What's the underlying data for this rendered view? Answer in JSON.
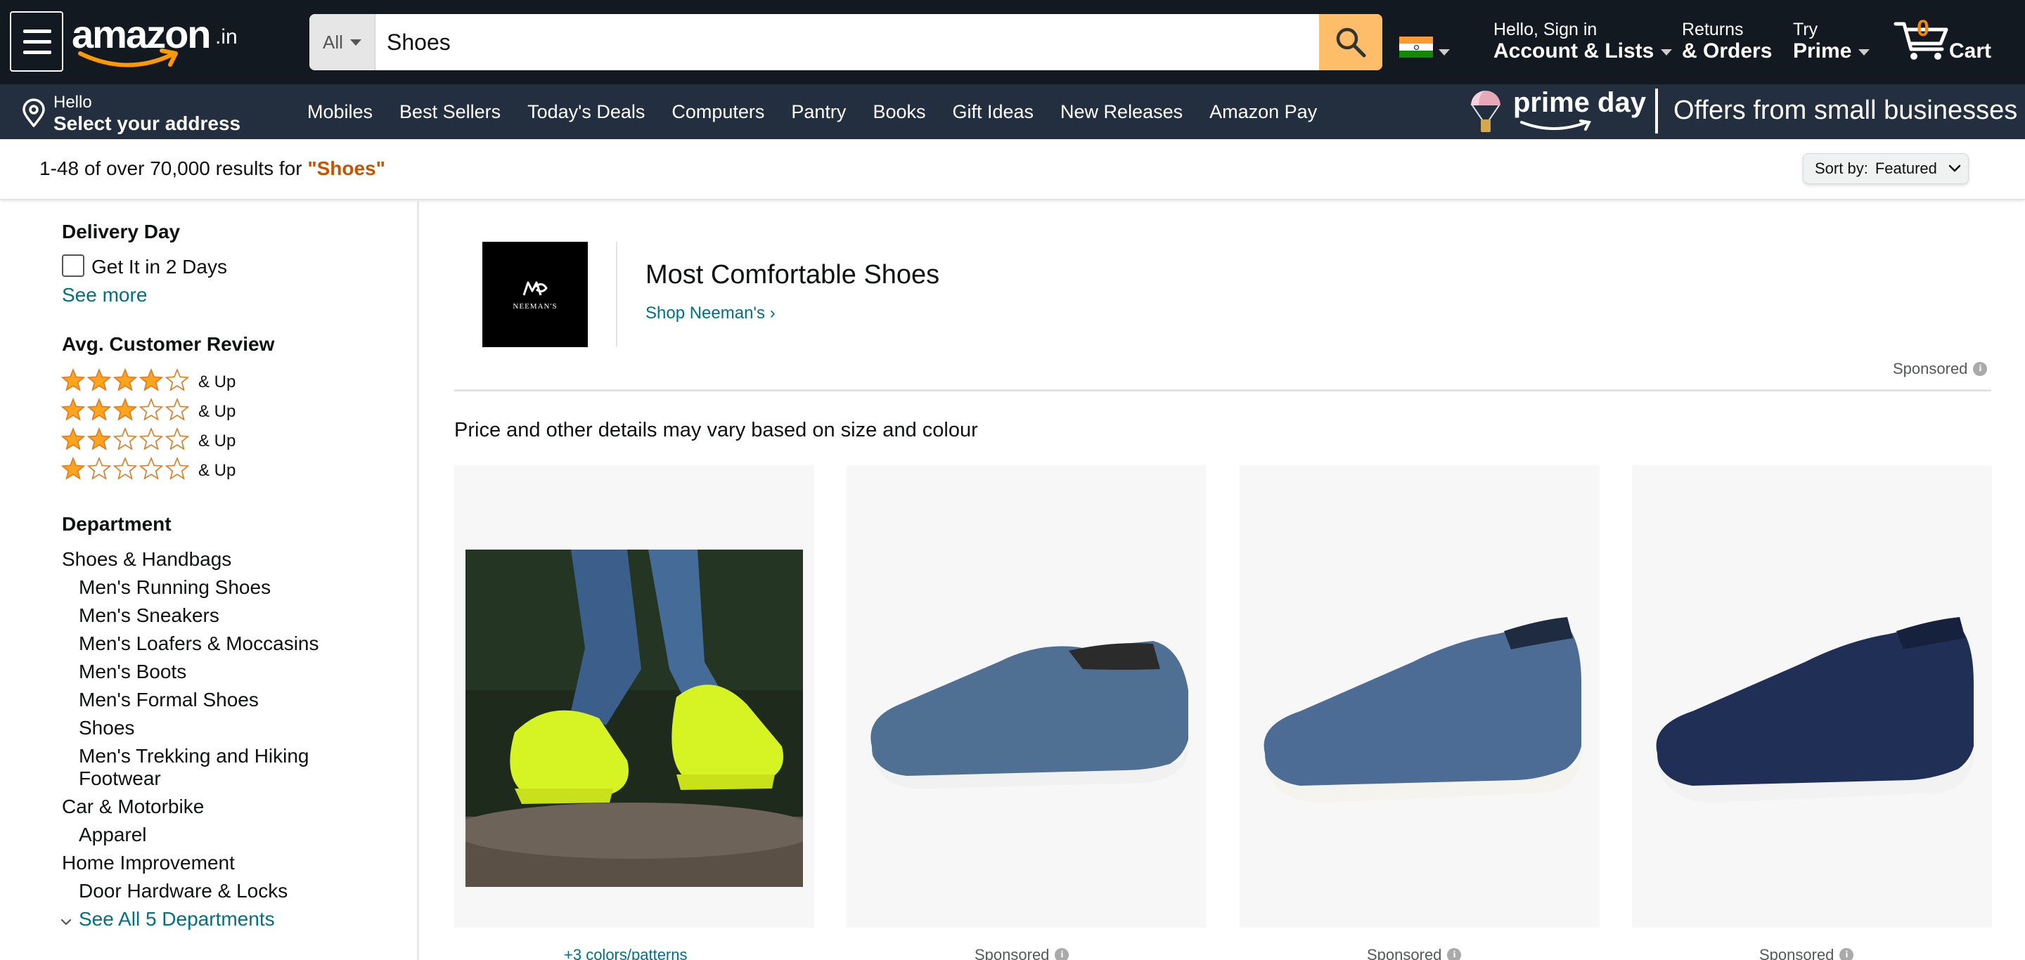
{
  "header": {
    "logo_word": "amazon",
    "logo_tld": ".in",
    "search": {
      "department": "All",
      "query": "Shoes"
    },
    "account": {
      "line1": "Hello, Sign in",
      "line2": "Account & Lists"
    },
    "orders": {
      "line1": "Returns",
      "line2": "& Orders"
    },
    "prime": {
      "line1": "Try",
      "line2": "Prime"
    },
    "cart": {
      "count": "0",
      "label": "Cart"
    }
  },
  "subnav": {
    "address": {
      "hello": "Hello",
      "main": "Select your address"
    },
    "links": [
      "Mobiles",
      "Best Sellers",
      "Today's Deals",
      "Computers",
      "Pantry",
      "Books",
      "Gift Ideas",
      "New Releases",
      "Amazon Pay"
    ],
    "banner": {
      "prime_word": "prime day",
      "tagline": "Offers from small businesses"
    }
  },
  "results": {
    "prefix": "1-48 of over 70,000 results for ",
    "query": "\"Shoes\"",
    "sort_label": "Sort by:",
    "sort_value": "Featured"
  },
  "sidebar": {
    "delivery": {
      "heading": "Delivery Day",
      "option": "Get It in 2 Days",
      "see_more": "See more"
    },
    "review": {
      "heading": "Avg. Customer Review",
      "rows": [
        {
          "stars": 4,
          "label": "& Up"
        },
        {
          "stars": 3,
          "label": "& Up"
        },
        {
          "stars": 2,
          "label": "& Up"
        },
        {
          "stars": 1,
          "label": "& Up"
        }
      ]
    },
    "department": {
      "heading": "Department",
      "items": [
        "Shoes & Handbags",
        "Men's Running Shoes",
        "Men's Sneakers",
        "Men's Loafers & Moccasins",
        "Men's Boots",
        "Men's Formal Shoes",
        "Shoes",
        "Men's Trekking and Hiking",
        "Footwear",
        "Car & Motorbike",
        "Apparel",
        "Home Improvement",
        "Door Hardware & Locks"
      ],
      "see_all": "See All 5 Departments"
    }
  },
  "brand": {
    "box_text": "NEEMAN'S",
    "headline": "Most Comfortable Shoes",
    "shop_link": "Shop Neeman's",
    "sponsored": "Sponsored"
  },
  "main": {
    "price_note": "Price and other details may vary based on size and colour",
    "products": [
      {
        "under": "+3 colors/patterns"
      },
      {
        "under": "Sponsored"
      },
      {
        "under": "Sponsored"
      },
      {
        "under": "Sponsored"
      }
    ]
  },
  "colors": {
    "nav_dark": "#131921",
    "nav_sub": "#232f3e",
    "search_button": "#febd69",
    "link": "#007185",
    "query_accent": "#c45500",
    "cart_count": "#f08804",
    "star": "#ffa41c"
  },
  "icons": {
    "menu": "hamburger-icon",
    "search": "magnifier-icon",
    "flag": "india-flag-icon",
    "cart": "cart-icon",
    "location": "location-pin-icon",
    "sort": "chevron-down-icon",
    "info": "info-icon"
  }
}
